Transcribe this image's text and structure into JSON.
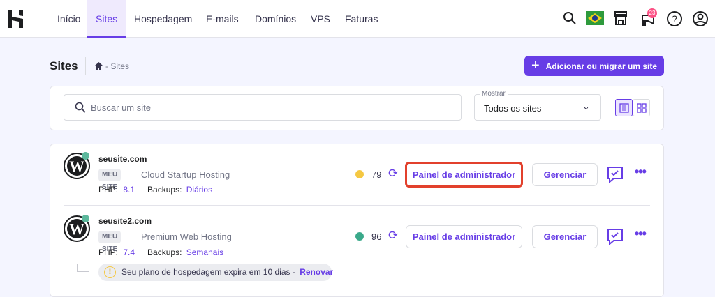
{
  "nav": {
    "items": [
      "Início",
      "Sites",
      "Hospedagem",
      "E-mails",
      "Domínios",
      "VPS",
      "Faturas"
    ],
    "active": "Sites",
    "notification_count": "23"
  },
  "header": {
    "title": "Sites",
    "breadcrumb": "- Sites",
    "add_button": "Adicionar ou migrar um site"
  },
  "filters": {
    "search_placeholder": "Buscar um site",
    "show_label": "Mostrar",
    "show_value": "Todos os sites"
  },
  "sites": [
    {
      "name": "seusite.com",
      "badge": "MEU SITE",
      "plan": "Cloud Startup Hosting",
      "php_label": "PHP:",
      "php": "8.1",
      "backups_label": "Backups:",
      "backups": "Diários",
      "score": "79",
      "score_color": "#f5c842",
      "admin_button": "Painel de administrador",
      "manage_button": "Gerenciar"
    },
    {
      "name": "seusite2.com",
      "badge": "MEU SITE",
      "plan": "Premium Web Hosting",
      "php_label": "PHP:",
      "php": "7.4",
      "backups_label": "Backups:",
      "backups": "Semanais",
      "score": "96",
      "score_color": "#3aa98a",
      "admin_button": "Painel de administrador",
      "manage_button": "Gerenciar",
      "warning": "Seu plano de hospedagem expira em 10 dias -",
      "warning_link": "Renovar"
    }
  ],
  "colors": {
    "accent": "#673de6",
    "highlight": "#e2402c"
  }
}
